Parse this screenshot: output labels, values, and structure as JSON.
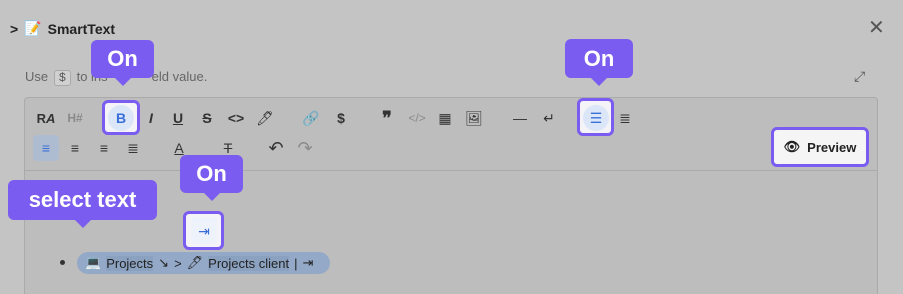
{
  "header": {
    "caret": ">",
    "title": "SmartText",
    "close_glyph": "✕"
  },
  "hint": {
    "prefix": "Use",
    "dollar": "$",
    "suffix_visible": "to ins",
    "suffix_tail": "eld value."
  },
  "expand_glyph": "⤢",
  "toolbar": {
    "row1": [
      "RA",
      "H#",
      "B",
      "I",
      "U",
      "S",
      "<>",
      "highlighter",
      "link",
      "$",
      "quote",
      "code-block",
      "table",
      "image",
      "—",
      "↵",
      "bullet-list",
      "numbered-list"
    ],
    "undo": "↶",
    "redo": "↷",
    "preview_label": "Preview"
  },
  "callouts": {
    "bold_on": "On",
    "bullet_on": "On",
    "indent_on": "On",
    "select_text": "select text"
  },
  "content": {
    "line_prefix_icon": "💻",
    "projects_label": "Projects",
    "arrow": "↘",
    "gt": ">",
    "client_label": "Projects client",
    "separator": "|"
  },
  "accent_color": "#7b5cf0"
}
